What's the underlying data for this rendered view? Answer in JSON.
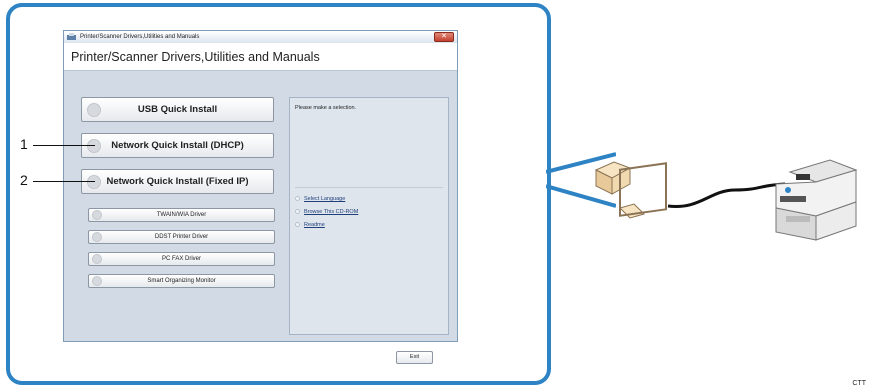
{
  "window": {
    "title_bar": "Printer/Scanner Drivers,Utilities and Manuals",
    "close_glyph": "✕",
    "heading": "Printer/Scanner Drivers,Utilities and Manuals"
  },
  "install_buttons": [
    {
      "label": "USB Quick Install",
      "icon": "cd-icon"
    },
    {
      "label": "Network Quick Install (DHCP)",
      "icon": "cd-icon"
    },
    {
      "label": "Network Quick Install (Fixed IP)",
      "icon": "cd-icon"
    }
  ],
  "driver_buttons": [
    {
      "label": "TWAIN/WIA Driver",
      "icon": "cd-icon"
    },
    {
      "label": "DDST Printer Driver",
      "icon": "cd-icon"
    },
    {
      "label": "PC FAX Driver",
      "icon": "cd-icon"
    },
    {
      "label": "Smart Organizing Monitor",
      "icon": "cd-icon"
    }
  ],
  "panel": {
    "message": "Please make a selection.",
    "links": [
      "Select Language",
      "Browse This CD-ROM",
      "Readme"
    ]
  },
  "exit_label": "Exit",
  "callouts": [
    "1",
    "2"
  ],
  "figure_code": "CTT",
  "colors": {
    "frame": "#2d83c4",
    "window_bg": "#d2dbe5"
  }
}
